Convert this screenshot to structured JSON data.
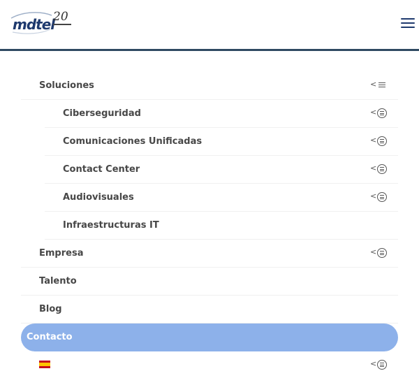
{
  "header": {
    "logo_text": "mdtel",
    "logo_badge": "20",
    "menu_icon": "hamburger-icon"
  },
  "menu": {
    "items": [
      {
        "label": "Soluciones",
        "level": 0,
        "toggle_icon": "list-icon"
      },
      {
        "label": "Ciberseguridad",
        "level": 1,
        "toggle_icon": "circle-list-icon"
      },
      {
        "label": "Comunicaciones Unificadas",
        "level": 1,
        "toggle_icon": "circle-list-icon"
      },
      {
        "label": "Contact Center",
        "level": 1,
        "toggle_icon": "circle-list-icon"
      },
      {
        "label": "Audiovisuales",
        "level": 1,
        "toggle_icon": "circle-list-icon"
      },
      {
        "label": "Infraestructuras IT",
        "level": 1,
        "toggle_icon": ""
      },
      {
        "label": "Empresa",
        "level": 0,
        "toggle_icon": "circle-list-icon"
      },
      {
        "label": "Talento",
        "level": 0,
        "toggle_icon": ""
      },
      {
        "label": "Blog",
        "level": 0,
        "toggle_icon": ""
      },
      {
        "label": "Contacto",
        "level": 0,
        "toggle_icon": "",
        "active": true
      }
    ],
    "language": {
      "flag_icon": "spain-flag-icon",
      "toggle_icon": "circle-list-icon"
    }
  },
  "colors": {
    "header_border": "#2f4a62",
    "active_bg": "#8db1ea",
    "text": "#474747",
    "brand": "#1f3a6e"
  }
}
